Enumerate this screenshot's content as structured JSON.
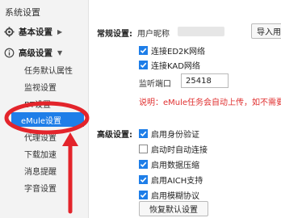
{
  "app_title": "系统设置",
  "sidebar": {
    "basic_group": "基本设置",
    "advanced_group": "高级设置",
    "items": [
      {
        "label": "任务默认属性"
      },
      {
        "label": "监视设置"
      },
      {
        "label": "BT设置"
      },
      {
        "label": "eMule设置"
      },
      {
        "label": "代理设置"
      },
      {
        "label": "下载加速"
      },
      {
        "label": "消息提醒"
      },
      {
        "label": "字音设置"
      }
    ]
  },
  "general": {
    "section_label": "常规设置:",
    "nickname_label": "用户昵称",
    "import_button": "导入用",
    "connect_ed2k": "连接ED2K网络",
    "connect_kad": "连接KAD网络",
    "port_label": "监听端口",
    "port_value": "25418",
    "note": "说明：eMule任务会自动上传，如不需要上"
  },
  "advanced": {
    "section_label": "高级设置:",
    "options": [
      {
        "label": "启用身份验证",
        "checked": true
      },
      {
        "label": "启动时自动连接",
        "checked": false
      },
      {
        "label": "启用数据压缩",
        "checked": true
      },
      {
        "label": "启用AICH支持",
        "checked": true
      },
      {
        "label": "启用模糊协议",
        "checked": true
      }
    ],
    "restore_button": "恢复默认设置"
  },
  "colors": {
    "accent": "#1e7ee8",
    "annotation_red": "#e3242b",
    "note_red": "#e03030"
  }
}
